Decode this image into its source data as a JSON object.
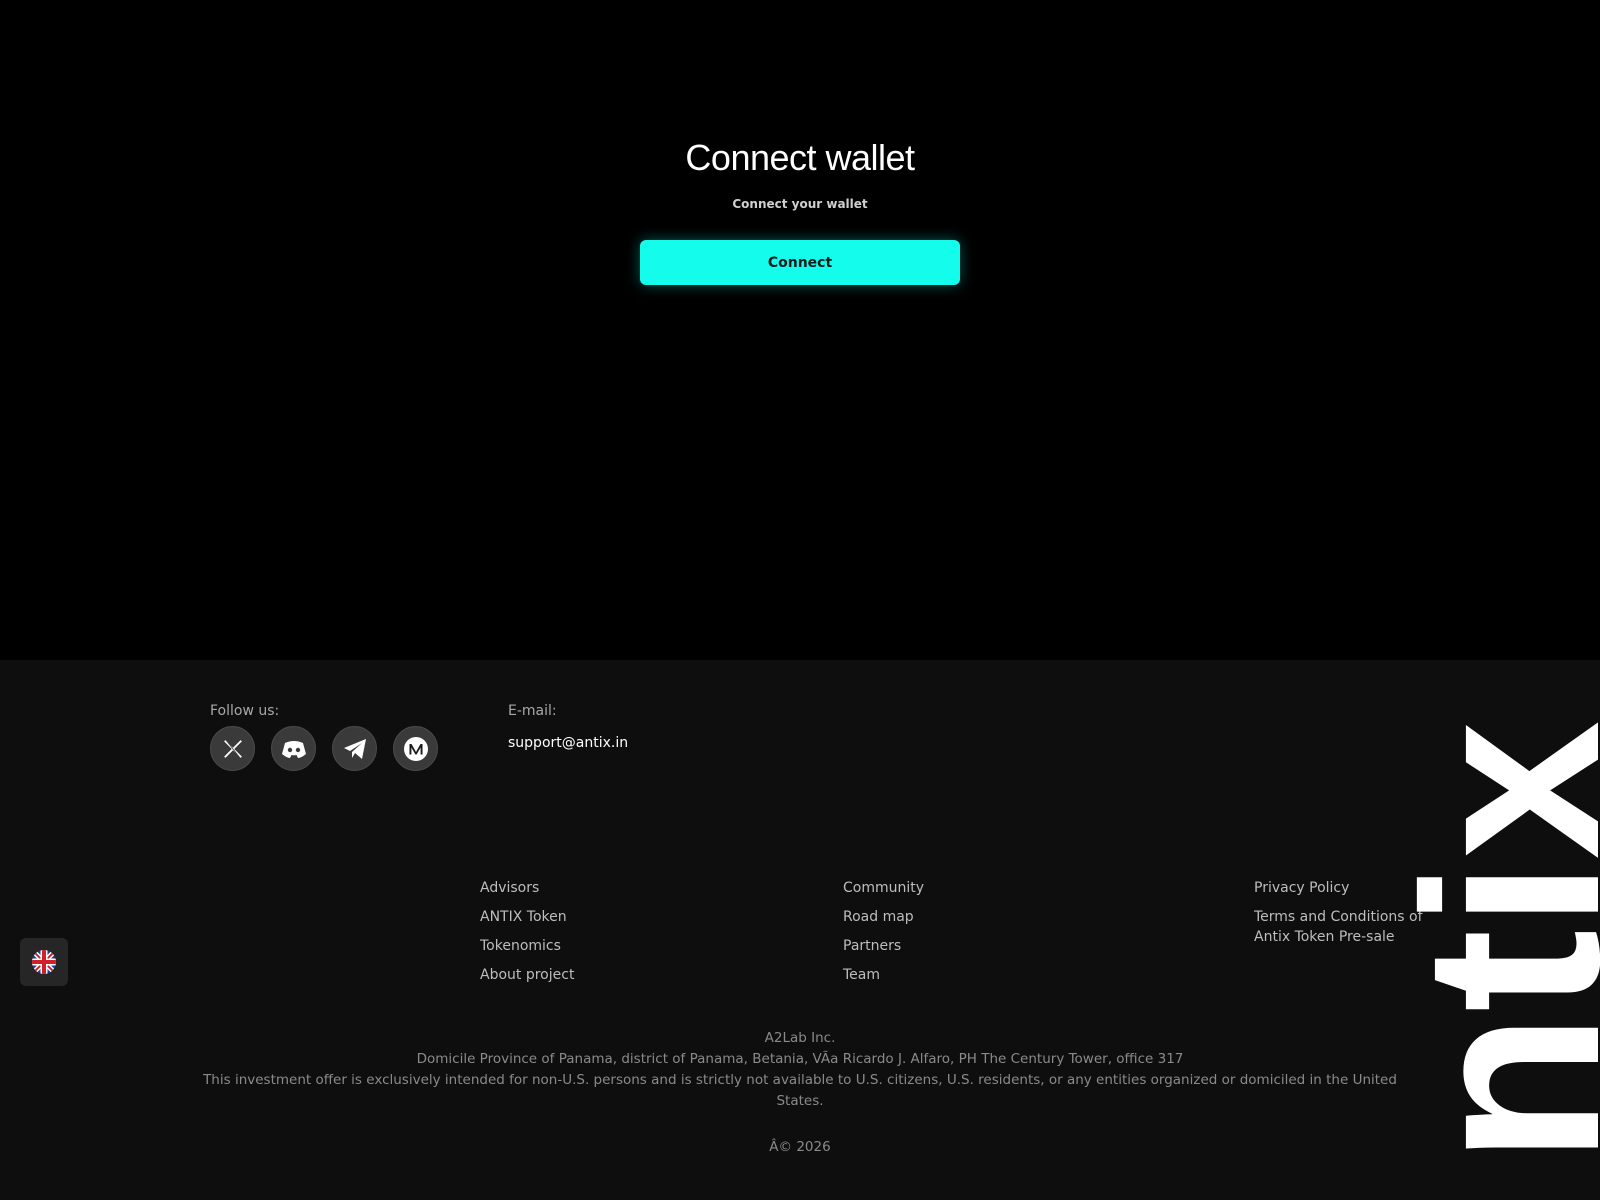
{
  "main": {
    "title": "Connect wallet",
    "subtitle": "Connect your wallet",
    "connect_label": "Connect",
    "accent_color": "#14fcec"
  },
  "footer": {
    "follow_label": "Follow us:",
    "socials": [
      {
        "icon": "x-icon"
      },
      {
        "icon": "discord-icon"
      },
      {
        "icon": "telegram-icon"
      },
      {
        "icon": "medium-icon"
      }
    ],
    "email_label": "E-mail:",
    "email": "support@antix.in",
    "links": {
      "col1": [
        "Advisors",
        "ANTIX Token",
        "Tokenomics",
        "About project"
      ],
      "col2": [
        "Community",
        "Road map",
        "Partners",
        "Team"
      ],
      "col3": [
        "Privacy Policy",
        "Terms and Conditions of Antix Token Pre-sale"
      ]
    },
    "company": "A2Lab Inc.",
    "address": "Domicile Province of Panama, district of Panama, Betania, VÃa Ricardo J. Alfaro, PH The Century Tower, office 317",
    "disclaimer": "This investment offer is exclusively intended for non-U.S. persons and is strictly not available to U.S. citizens, U.S. residents, or any entities organized or domiciled in the United States.",
    "copyright": "Â© 2026",
    "brand_logo_text": "ntix"
  },
  "language": {
    "icon": "uk-flag-icon"
  }
}
